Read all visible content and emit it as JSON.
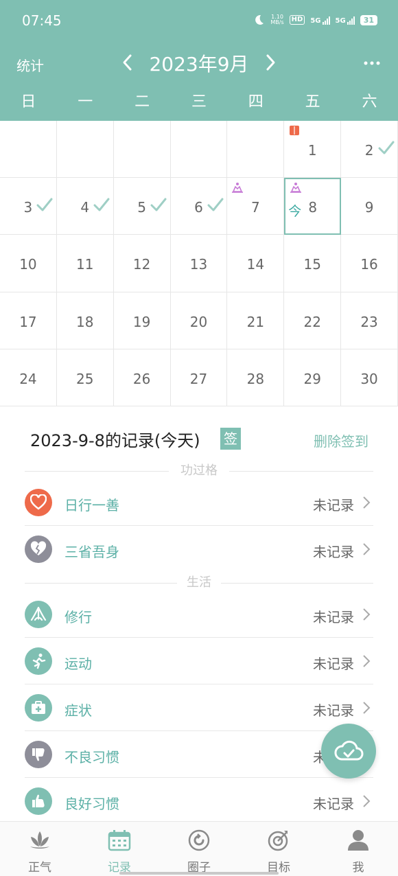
{
  "status_bar": {
    "time": "07:45",
    "net_speed_value": "1.10",
    "net_speed_unit": "MB/s",
    "hd_label": "HD",
    "sig1_label": "5G",
    "sig2_label": "5G",
    "battery": "31"
  },
  "header": {
    "stats_label": "统计",
    "month_title": "2023年9月"
  },
  "weekdays": [
    "日",
    "一",
    "二",
    "三",
    "四",
    "五",
    "六"
  ],
  "calendar": {
    "days": [
      {
        "day": "1",
        "col": 5,
        "row": 0,
        "mark": "book"
      },
      {
        "day": "2",
        "col": 6,
        "row": 0,
        "check": true
      },
      {
        "day": "3",
        "col": 0,
        "row": 1,
        "check": true
      },
      {
        "day": "4",
        "col": 1,
        "row": 1,
        "check": true
      },
      {
        "day": "5",
        "col": 2,
        "row": 1,
        "check": true
      },
      {
        "day": "6",
        "col": 3,
        "row": 1,
        "check": true
      },
      {
        "day": "7",
        "col": 4,
        "row": 1,
        "mark": "lotus"
      },
      {
        "day": "8",
        "col": 5,
        "row": 1,
        "mark": "lotus",
        "today": true
      },
      {
        "day": "9",
        "col": 6,
        "row": 1
      },
      {
        "day": "10",
        "col": 0,
        "row": 2
      },
      {
        "day": "11",
        "col": 1,
        "row": 2
      },
      {
        "day": "12",
        "col": 2,
        "row": 2
      },
      {
        "day": "13",
        "col": 3,
        "row": 2
      },
      {
        "day": "14",
        "col": 4,
        "row": 2
      },
      {
        "day": "15",
        "col": 5,
        "row": 2
      },
      {
        "day": "16",
        "col": 6,
        "row": 2
      },
      {
        "day": "17",
        "col": 0,
        "row": 3
      },
      {
        "day": "18",
        "col": 1,
        "row": 3
      },
      {
        "day": "19",
        "col": 2,
        "row": 3
      },
      {
        "day": "20",
        "col": 3,
        "row": 3
      },
      {
        "day": "21",
        "col": 4,
        "row": 3
      },
      {
        "day": "22",
        "col": 5,
        "row": 3
      },
      {
        "day": "23",
        "col": 6,
        "row": 3
      },
      {
        "day": "24",
        "col": 0,
        "row": 4
      },
      {
        "day": "25",
        "col": 1,
        "row": 4
      },
      {
        "day": "26",
        "col": 2,
        "row": 4
      },
      {
        "day": "27",
        "col": 3,
        "row": 4
      },
      {
        "day": "28",
        "col": 4,
        "row": 4
      },
      {
        "day": "29",
        "col": 5,
        "row": 4
      },
      {
        "day": "30",
        "col": 6,
        "row": 4
      }
    ],
    "today_tag": "今"
  },
  "records": {
    "title": "2023-9-8的记录(今天)",
    "sign_badge": "签",
    "delete_label": "删除签到",
    "section1_label": "功过格",
    "section2_label": "生活",
    "items": [
      {
        "label": "日行一善",
        "status": "未记录",
        "icon": "heart-icon",
        "color": "#ee6a4a"
      },
      {
        "label": "三省吾身",
        "status": "未记录",
        "icon": "broken-heart-icon",
        "color": "#8e8e99"
      },
      {
        "label": "修行",
        "status": "未记录",
        "icon": "lotus-hands-icon",
        "color": "#7fbfb2"
      },
      {
        "label": "运动",
        "status": "未记录",
        "icon": "running-icon",
        "color": "#7fbfb2"
      },
      {
        "label": "症状",
        "status": "未记录",
        "icon": "medkit-icon",
        "color": "#7fbfb2"
      },
      {
        "label": "不良习惯",
        "status": "未记录",
        "icon": "thumbs-down-icon",
        "color": "#8e8e99"
      },
      {
        "label": "良好习惯",
        "status": "未记录",
        "icon": "thumbs-up-icon",
        "color": "#7fbfb2"
      }
    ]
  },
  "tabbar": {
    "tabs": [
      {
        "label": "正气",
        "icon": "lotus-icon"
      },
      {
        "label": "记录",
        "icon": "calendar-icon",
        "active": true
      },
      {
        "label": "圈子",
        "icon": "circle-icon"
      },
      {
        "label": "目标",
        "icon": "target-icon"
      },
      {
        "label": "我",
        "icon": "user-icon"
      }
    ]
  },
  "colors": {
    "accent": "#7fbfb2",
    "today_border": "#7fbfb2",
    "mark_lotus": "#c77bd6",
    "mark_book": "#ee6a4a"
  }
}
